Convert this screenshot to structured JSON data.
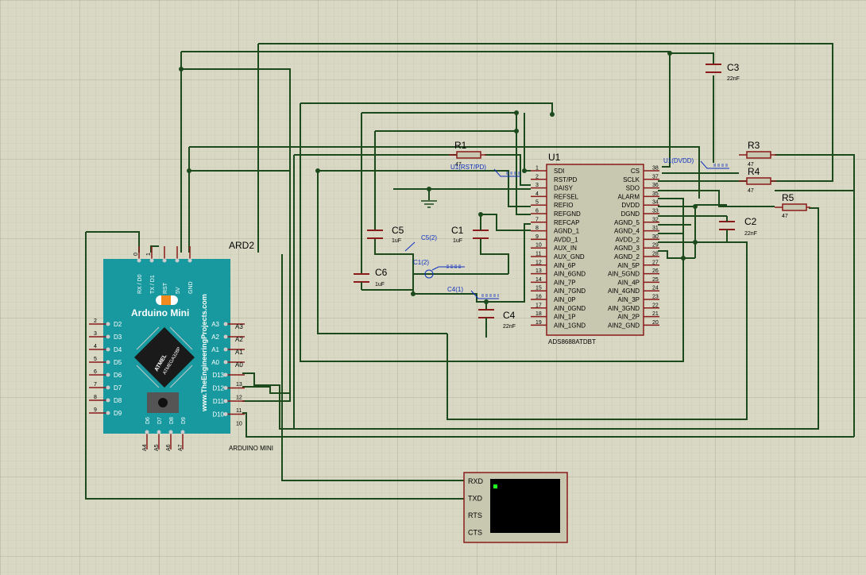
{
  "arduino": {
    "ref": "ARD2",
    "title": "Arduino Mini",
    "chip_brand": "ATMEL",
    "chip_model": "ATMEGA328P",
    "website": "www.TheEngineeringProjects.com",
    "footer": "ARDUINO MINI",
    "top_pin_numbers": [
      "0",
      "1"
    ],
    "top_pins": [
      "RX / D0",
      "TX / D1",
      "RST",
      "5V",
      "GND"
    ],
    "left_pin_numbers": [
      "2",
      "3",
      "4",
      "5",
      "6",
      "7",
      "8",
      "9"
    ],
    "left_pins": [
      "D2",
      "D3",
      "D4",
      "D5",
      "D6",
      "D7",
      "D8",
      "D9"
    ],
    "right_analog": [
      "A3",
      "A2",
      "A1",
      "A0"
    ],
    "right_analog_outer": [
      "A3",
      "A2",
      "A1",
      "A0"
    ],
    "right_digital": [
      "D13",
      "D12",
      "D11",
      "D10"
    ],
    "right_digital_numbers": [
      "13",
      "12",
      "11",
      "10"
    ],
    "bottom_pins": [
      "D6",
      "D7",
      "D8",
      "D9"
    ],
    "bottom_outer": [
      "A4",
      "A5",
      "A6",
      "A7"
    ]
  },
  "u1": {
    "ref": "U1",
    "part": "ADS8688ATDBT",
    "left_pins": [
      {
        "n": "1",
        "name": "SDI"
      },
      {
        "n": "2",
        "name": "RST/PD"
      },
      {
        "n": "3",
        "name": "DAISY"
      },
      {
        "n": "4",
        "name": "REFSEL"
      },
      {
        "n": "5",
        "name": "REFIO"
      },
      {
        "n": "6",
        "name": "REFGND"
      },
      {
        "n": "7",
        "name": "REFCAP"
      },
      {
        "n": "8",
        "name": "AGND_1"
      },
      {
        "n": "9",
        "name": "AVDD_1"
      },
      {
        "n": "10",
        "name": "AUX_IN"
      },
      {
        "n": "11",
        "name": "AUX_GND"
      },
      {
        "n": "12",
        "name": "AIN_6P"
      },
      {
        "n": "13",
        "name": "AIN_6GND"
      },
      {
        "n": "14",
        "name": "AIN_7P"
      },
      {
        "n": "15",
        "name": "AIN_7GND"
      },
      {
        "n": "16",
        "name": "AIN_0P"
      },
      {
        "n": "17",
        "name": "AIN_0GND"
      },
      {
        "n": "18",
        "name": "AIN_1P"
      },
      {
        "n": "19",
        "name": "AIN_1GND"
      }
    ],
    "right_pins": [
      {
        "n": "38",
        "name": "CS"
      },
      {
        "n": "37",
        "name": "SCLK"
      },
      {
        "n": "36",
        "name": "SDO"
      },
      {
        "n": "35",
        "name": "ALARM"
      },
      {
        "n": "34",
        "name": "DVDD"
      },
      {
        "n": "33",
        "name": "DGND"
      },
      {
        "n": "32",
        "name": "AGND_5"
      },
      {
        "n": "31",
        "name": "AGND_4"
      },
      {
        "n": "30",
        "name": "AVDD_2"
      },
      {
        "n": "29",
        "name": "AGND_3"
      },
      {
        "n": "28",
        "name": "AGND_2"
      },
      {
        "n": "27",
        "name": "AIN_5P"
      },
      {
        "n": "26",
        "name": "AIN_5GND"
      },
      {
        "n": "25",
        "name": "AIN_4P"
      },
      {
        "n": "24",
        "name": "AIN_4GND"
      },
      {
        "n": "23",
        "name": "AIN_3P"
      },
      {
        "n": "22",
        "name": "AIN_3GND"
      },
      {
        "n": "21",
        "name": "AIN_2P"
      },
      {
        "n": "20",
        "name": "AIN2_GND"
      }
    ]
  },
  "components": {
    "r1": {
      "ref": "R1",
      "value": "47"
    },
    "r3": {
      "ref": "R3",
      "value": "47"
    },
    "r4": {
      "ref": "R4",
      "value": "47"
    },
    "r5": {
      "ref": "R5",
      "value": "47"
    },
    "c1": {
      "ref": "C1",
      "value": "1uF"
    },
    "c2": {
      "ref": "C2",
      "value": "22nF"
    },
    "c3": {
      "ref": "C3",
      "value": "22nF"
    },
    "c4": {
      "ref": "C4",
      "value": "22nF"
    },
    "c5": {
      "ref": "C5",
      "value": "1uF"
    },
    "c6": {
      "ref": "C6",
      "value": "1uF"
    }
  },
  "probes": {
    "rst": "U1(RST/PD)",
    "dvdd": "U1(DVDD)",
    "c5": "C5(2)",
    "c1": "C1(2)",
    "c4": "C4(1)"
  },
  "terminal": {
    "pins": [
      "RXD",
      "TXD",
      "RTS",
      "CTS"
    ]
  }
}
